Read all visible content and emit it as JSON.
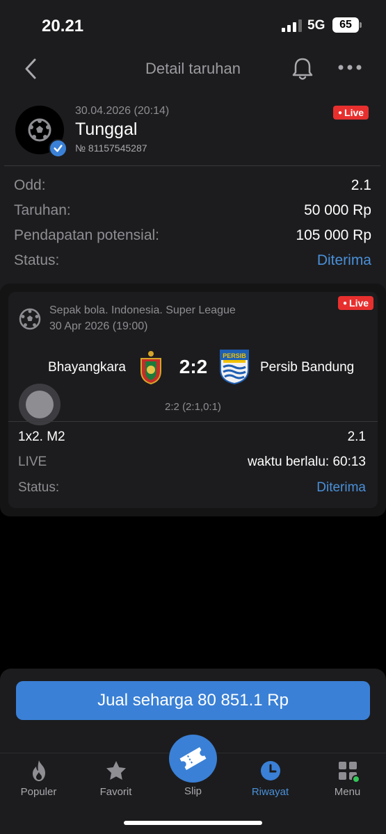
{
  "status_bar": {
    "time": "20.21",
    "network": "5G",
    "battery": "65"
  },
  "nav": {
    "title": "Detail taruhan"
  },
  "bet": {
    "date": "30.04.2026 (20:14)",
    "type": "Tunggal",
    "number": "№ 81157545287",
    "live_label": "Live"
  },
  "summary": {
    "rows": [
      {
        "label": "Odd:",
        "value": "2.1"
      },
      {
        "label": "Taruhan:",
        "value": "50 000 Rp"
      },
      {
        "label": "Pendapatan potensial:",
        "value": "105 000 Rp"
      },
      {
        "label": "Status:",
        "value": "Diterima"
      }
    ]
  },
  "event": {
    "league": "Sepak bola. Indonesia. Super League",
    "date": "30 Apr 2026 (19:00)",
    "live_label": "Live",
    "home_team": "Bhayangkara",
    "away_team": "Persib Bandung",
    "away_crest_text": "PERSIB",
    "score": "2:2",
    "score_detail": "2:2 (2:1,0:1)",
    "market": {
      "label": "1x2. M2",
      "value": "2.1"
    },
    "live_row": {
      "label": "LIVE",
      "value": "waktu berlalu: 60:13"
    },
    "status_row": {
      "label": "Status:",
      "value": "Diterima"
    }
  },
  "sell_button": "Jual seharga 80 851.1 Rp",
  "tabs": [
    {
      "label": "Populer",
      "icon": "flame-icon"
    },
    {
      "label": "Favorit",
      "icon": "star-icon"
    },
    {
      "label": "Slip",
      "icon": "ticket-icon"
    },
    {
      "label": "Riwayat",
      "icon": "clock-icon"
    },
    {
      "label": "Menu",
      "icon": "grid-icon"
    }
  ],
  "colors": {
    "accent": "#3a80d6",
    "status_accepted": "#4a90d9",
    "live": "#e7302e",
    "notification_dot": "#34c759"
  }
}
